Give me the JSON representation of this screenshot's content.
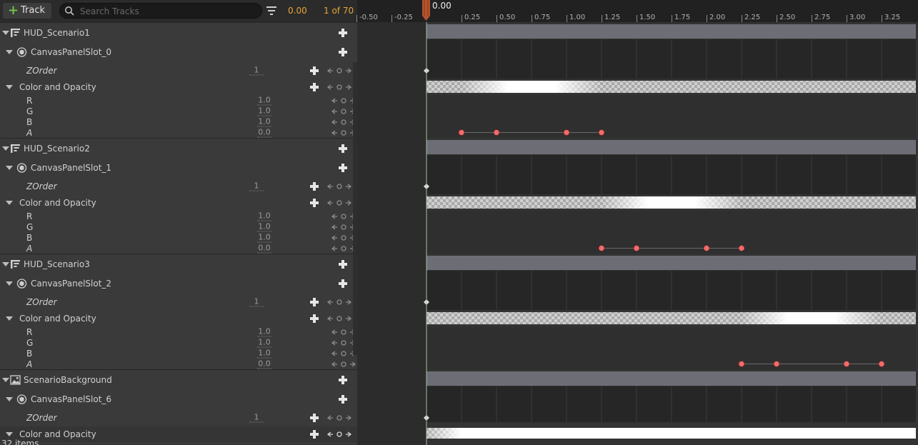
{
  "toolbar": {
    "track_label": "Track",
    "search_placeholder": "Search Tracks",
    "current_time": "0.00",
    "frame_count": "1 of 70"
  },
  "ruler": {
    "playhead_time": "0.00",
    "ticks": [
      "-0.50",
      "-0.25",
      "0.25",
      "0.50",
      "0.75",
      "1.00",
      "1.25",
      "1.50",
      "1.75",
      "2.00",
      "2.25",
      "2.50",
      "2.75",
      "3.00",
      "3.25"
    ]
  },
  "tracks": [
    {
      "type": "widget",
      "label": "HUD_Scenario1",
      "icon": "widget-icon"
    },
    {
      "type": "slot",
      "label": "CanvasPanelSlot_0",
      "icon": "slot-icon"
    },
    {
      "type": "prop",
      "label": "ZOrder",
      "value": "1"
    },
    {
      "type": "group",
      "label": "Color and Opacity"
    },
    {
      "type": "chan",
      "label": "R",
      "value": "1.0"
    },
    {
      "type": "chan",
      "label": "G",
      "value": "1.0"
    },
    {
      "type": "chan",
      "label": "B",
      "value": "1.0"
    },
    {
      "type": "chan",
      "label": "A",
      "value": "0.0",
      "italic": true
    },
    {
      "type": "widget",
      "label": "HUD_Scenario2",
      "icon": "widget-icon"
    },
    {
      "type": "slot",
      "label": "CanvasPanelSlot_1",
      "icon": "slot-icon"
    },
    {
      "type": "prop",
      "label": "ZOrder",
      "value": "1"
    },
    {
      "type": "group",
      "label": "Color and Opacity"
    },
    {
      "type": "chan",
      "label": "R",
      "value": "1.0"
    },
    {
      "type": "chan",
      "label": "G",
      "value": "1.0"
    },
    {
      "type": "chan",
      "label": "B",
      "value": "1.0"
    },
    {
      "type": "chan",
      "label": "A",
      "value": "0.0",
      "italic": true
    },
    {
      "type": "widget",
      "label": "HUD_Scenario3",
      "icon": "widget-icon"
    },
    {
      "type": "slot",
      "label": "CanvasPanelSlot_2",
      "icon": "slot-icon"
    },
    {
      "type": "prop",
      "label": "ZOrder",
      "value": "1"
    },
    {
      "type": "group",
      "label": "Color and Opacity"
    },
    {
      "type": "chan",
      "label": "R",
      "value": "1.0"
    },
    {
      "type": "chan",
      "label": "G",
      "value": "1.0"
    },
    {
      "type": "chan",
      "label": "B",
      "value": "1.0"
    },
    {
      "type": "chan",
      "label": "A",
      "value": "0.0",
      "italic": true
    },
    {
      "type": "widget",
      "label": "ScenarioBackground",
      "icon": "image-widget-icon"
    },
    {
      "type": "slot",
      "label": "CanvasPanelSlot_6",
      "icon": "slot-icon"
    },
    {
      "type": "prop",
      "label": "ZOrder",
      "value": "1"
    },
    {
      "type": "group",
      "label": "Color and Opacity"
    }
  ],
  "status": {
    "items_count": "32 items"
  },
  "keyframes": [
    {
      "scenario": "HUD_Scenario1",
      "times": [
        0.25,
        0.5,
        1.0,
        1.25
      ]
    },
    {
      "scenario": "HUD_Scenario2",
      "times": [
        1.25,
        1.5,
        2.0,
        2.25
      ]
    },
    {
      "scenario": "HUD_Scenario3",
      "times": [
        2.25,
        2.5,
        3.0,
        3.25
      ]
    }
  ],
  "colors": {
    "accent_time": "#e8a43a",
    "keyframe": "#f06c6c",
    "playhead": "#b5532e",
    "add_green": "#6fc24a"
  }
}
